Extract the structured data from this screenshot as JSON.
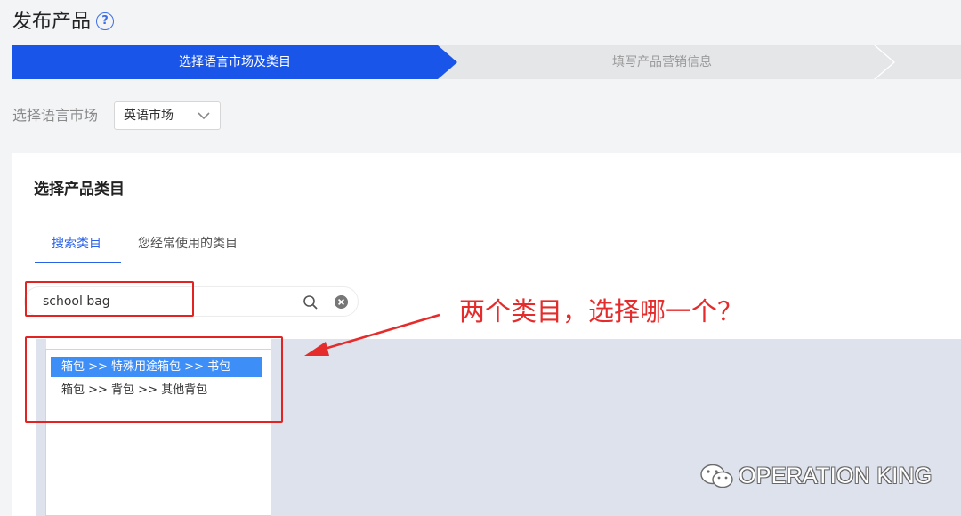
{
  "header": {
    "title": "发布产品",
    "help_icon": "?"
  },
  "steps": [
    {
      "label": "选择语言市场及类目",
      "state": "active"
    },
    {
      "label": "填写产品营销信息",
      "state": "inactive"
    },
    {
      "label": "",
      "state": "inactive"
    }
  ],
  "market": {
    "label": "选择语言市场",
    "selected": "英语市场"
  },
  "category_panel": {
    "title": "选择产品类目",
    "tabs": [
      {
        "label": "搜索类目",
        "active": true
      },
      {
        "label": "您经常使用的类目",
        "active": false
      }
    ],
    "search": {
      "value": "school bag"
    },
    "results": [
      {
        "label": "箱包 >> 特殊用途箱包 >> 书包",
        "selected": true
      },
      {
        "label": "箱包 >> 背包 >> 其他背包",
        "selected": false
      }
    ]
  },
  "annotation": {
    "text": "两个类目，选择哪一个？"
  },
  "watermark": {
    "text": "OPERATION KING"
  },
  "colors": {
    "primary": "#1a55ea",
    "selected_item": "#3e8ef7",
    "annotation_red": "#e52b2b"
  }
}
